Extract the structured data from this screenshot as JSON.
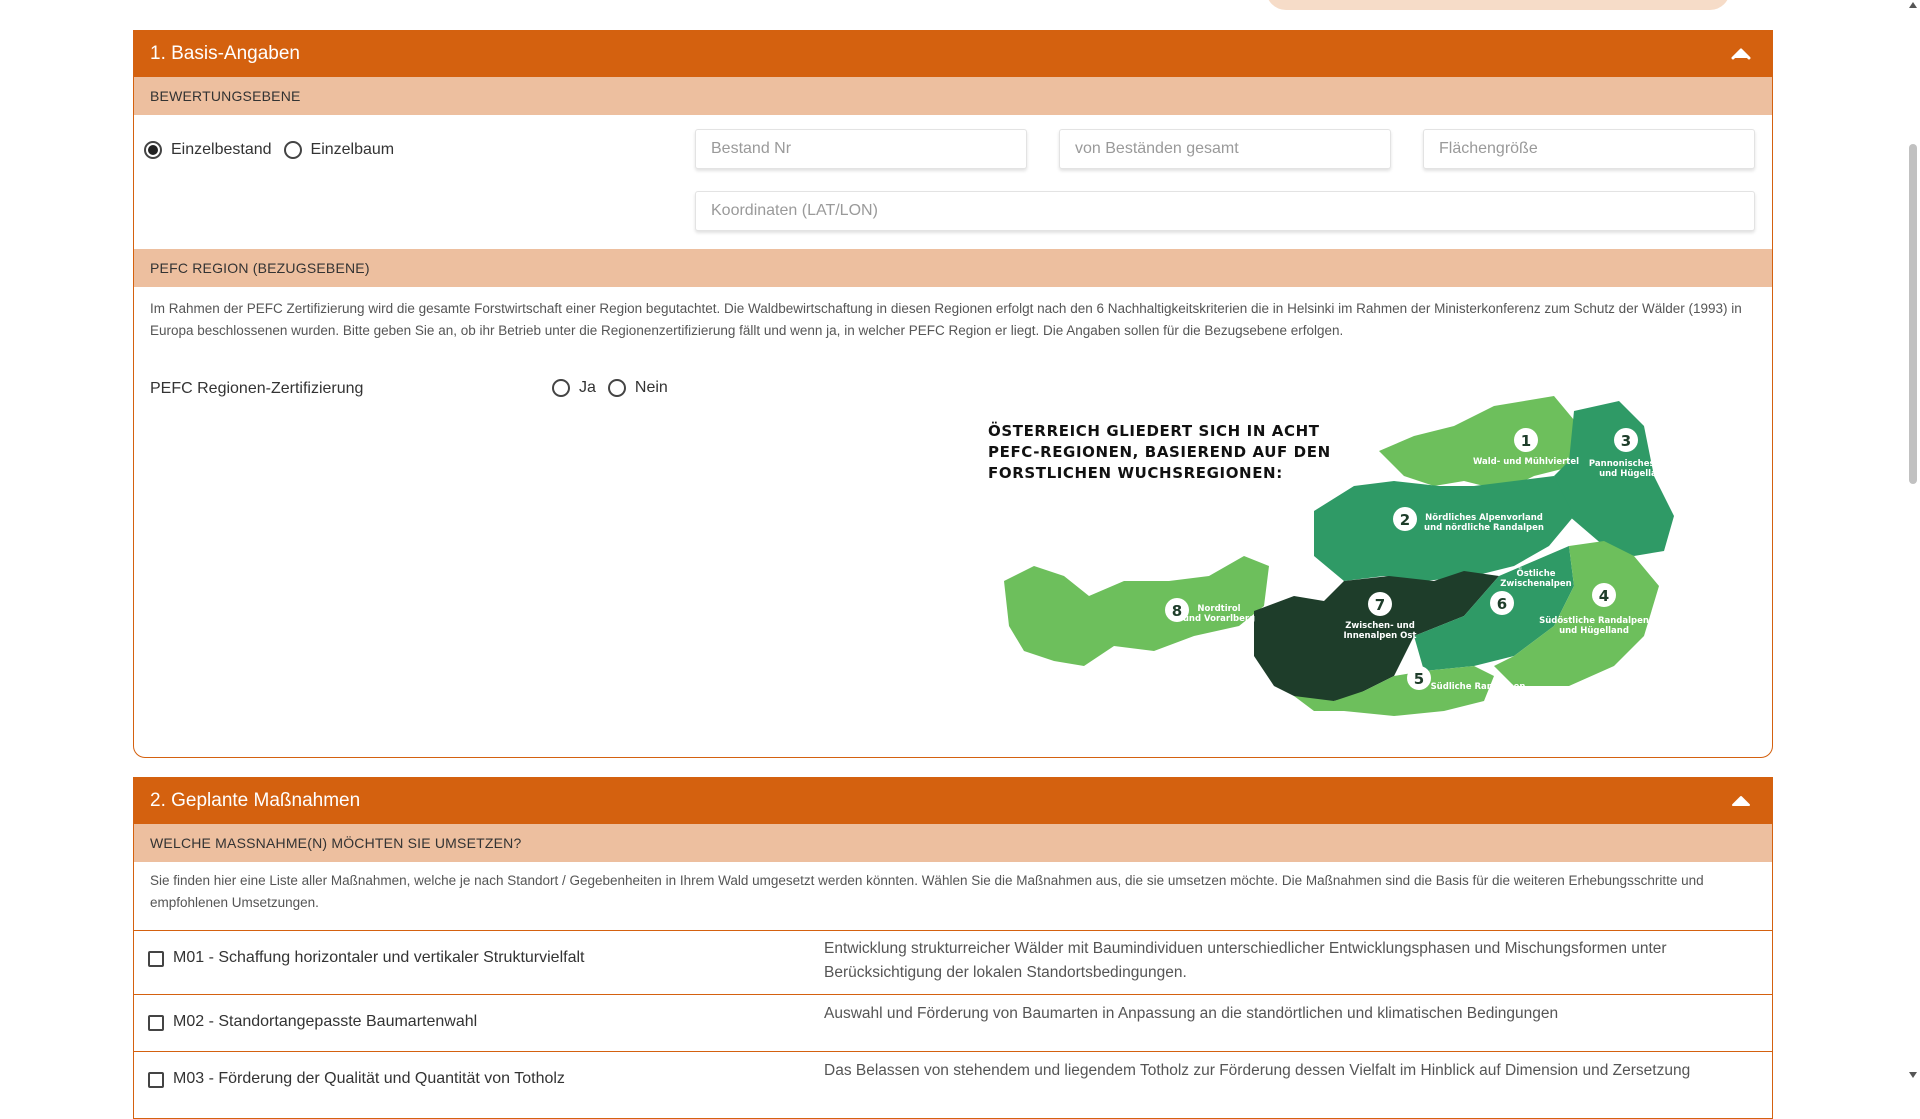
{
  "section1": {
    "title": "1. Basis-Angaben",
    "subhead_bewertung": "BEWERTUNGSEBENE",
    "radio_einzelbestand": "Einzelbestand",
    "radio_einzelbaum": "Einzelbaum",
    "selected_level": "Einzelbestand",
    "bestand_nr_placeholder": "Bestand Nr",
    "von_bestaenden_placeholder": "von Beständen gesamt",
    "flaechengroesse_placeholder": "Flächengröße",
    "koordinaten_placeholder": "Koordinaten (LAT/LON)",
    "subhead_pefc": "PEFC REGION (BEZUGSEBENE)",
    "pefc_description": "Im Rahmen der PEFC Zertifizierung wird die gesamte Forstwirtschaft einer Region begutachtet. Die Waldbewirtschaftung in diesen Regionen erfolgt nach den 6 Nachhaltigkeitskriterien die in Helsinki im Rahmen der Ministerkonferenz zum Schutz der Wälder (1993) in Europa beschlossenen wurden. Bitte geben Sie an, ob ihr Betrieb unter die Regionenzertifizierung fällt und wenn ja, in welcher PEFC Region er liegt. Die Angaben sollen für die Bezugsebene erfolgen.",
    "pefc_label": "PEFC Regionen-Zertifizierung",
    "pefc_yes": "Ja",
    "pefc_no": "Nein",
    "map": {
      "title_line1": "ÖSTERREICH GLIEDERT SICH IN ACHT",
      "title_line2": "PEFC-REGIONEN, BASIEREND AUF DEN",
      "title_line3": "FORSTLICHEN WUCHSREGIONEN:",
      "regions": [
        {
          "num": "1",
          "name": "Wald- und Mühlviertel"
        },
        {
          "num": "2",
          "name_l1": "Nördliches Alpenvorland",
          "name_l2": "und nördliche Randalpen"
        },
        {
          "num": "3",
          "name_l1": "Pannonisches Tief-",
          "name_l2": "und Hügelland"
        },
        {
          "num": "4",
          "name_l1": "Südöstliche Randalpen",
          "name_l2": "und Hügelland"
        },
        {
          "num": "5",
          "name": "Südliche Randalpen"
        },
        {
          "num": "6",
          "name_l1": "Östliche",
          "name_l2": "Zwischenalpen"
        },
        {
          "num": "7",
          "name_l1": "Zwischen- und",
          "name_l2": "Innenalpen Ost"
        },
        {
          "num": "8",
          "name_l1": "Nordtirol",
          "name_l2": "und Vorarlberg"
        }
      ]
    }
  },
  "section2": {
    "title": "2. Geplante Maßnahmen",
    "subhead": "WELCHE MASSNAHME(N) MÖCHTEN SIE UMSETZEN?",
    "description": "Sie finden hier eine Liste aller Maßnahmen, welche je nach Standort / Gegebenheiten in Ihrem Wald umgesetzt werden könnten. Wählen Sie die Maßnahmen aus, die sie umsetzen möchte. Die Maßnahmen sind die Basis für die weiteren Erhebungsschritte und empfohlenen Umsetzungen.",
    "measures": [
      {
        "label": "M01 - Schaffung horizontaler und vertikaler Strukturvielfalt",
        "desc": "Entwicklung strukturreicher Wälder mit Baumindividuen unterschiedlicher Entwicklungsphasen und Mischungsformen unter Berücksichtigung der lokalen Standortsbedingungen."
      },
      {
        "label": "M02 - Standortangepasste Baumartenwahl",
        "desc": "Auswahl und Förderung von Baumarten in Anpassung an die standörtlichen und klimatischen Bedingungen"
      },
      {
        "label": "M03 - Förderung der Qualität und Quantität von Totholz",
        "desc": "Das Belassen von stehendem und liegendem Totholz zur Förderung dessen Vielfalt im Hinblick auf Dimension und Zersetzung"
      }
    ]
  },
  "colors": {
    "header_orange": "#d4610f",
    "subhead_peach": "#edbf9f",
    "map_light_green": "#6dbf5c",
    "map_mid_green": "#2f9a66",
    "map_dark_green": "#1e3d2a"
  }
}
